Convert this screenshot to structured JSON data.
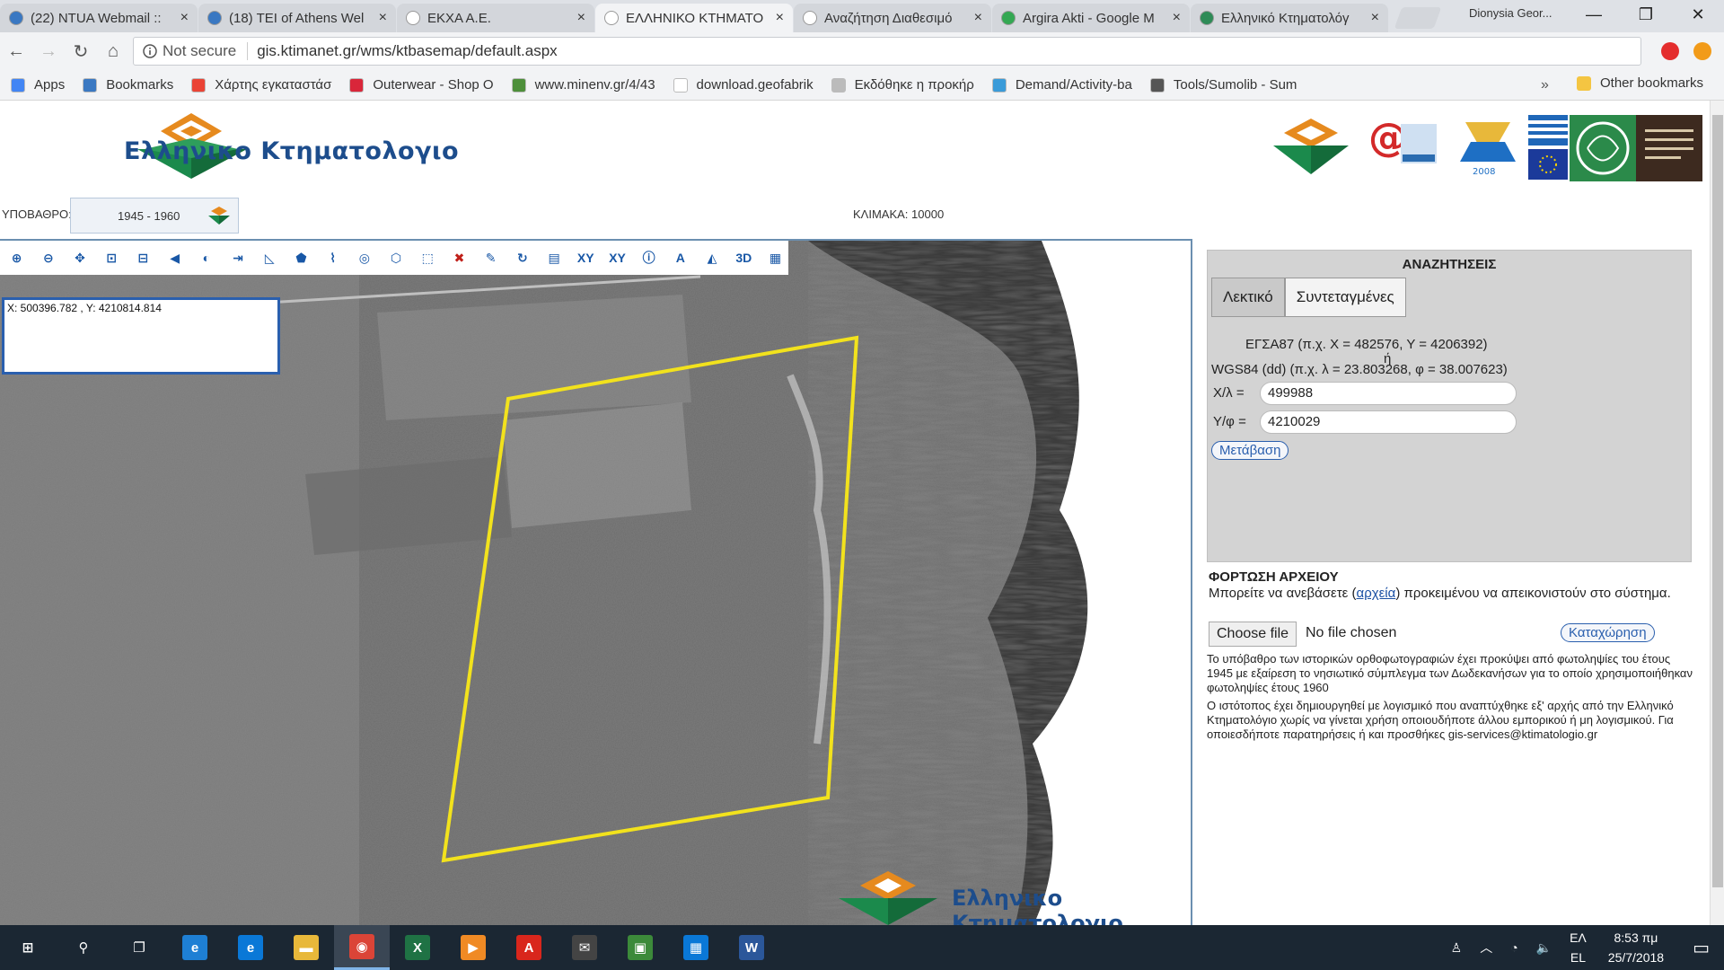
{
  "browser": {
    "tabs": [
      {
        "label": "(22) NTUA Webmail ::",
        "fav": "#3a78c2",
        "active": false
      },
      {
        "label": "(18) TEI of Athens Wel",
        "fav": "#3a78c2",
        "active": false
      },
      {
        "label": "ΕΚΧΑ Α.Ε.",
        "fav": "#ffffff",
        "active": false
      },
      {
        "label": "ΕΛΛΗΝΙΚΟ ΚΤΗΜΑΤΟ",
        "fav": "#ffffff",
        "active": true
      },
      {
        "label": "Αναζήτηση Διαθεσιμό",
        "fav": "#ffffff",
        "active": false
      },
      {
        "label": "Argira Akti - Google M",
        "fav": "#34a853",
        "active": false
      },
      {
        "label": "Ελληνικό Κτηματολόγ",
        "fav": "#2e8b57",
        "active": false
      }
    ],
    "tab_close": "×",
    "profile_name": "Dionysia Geor...",
    "window_buttons": [
      "—",
      "❐",
      "✕"
    ],
    "nav_icons": [
      "←",
      "→",
      "↻",
      "⌂"
    ],
    "security_text": "Not secure",
    "url": "gis.ktimanet.gr/wms/ktbasemap/default.aspx",
    "star": "☆"
  },
  "bookmarks": {
    "items": [
      {
        "label": "Apps",
        "color": "#4285f4"
      },
      {
        "label": "Bookmarks",
        "color": "#3a78c2"
      },
      {
        "label": "Χάρτης εγκαταστάσ",
        "color": "#ea4335"
      },
      {
        "label": "Outerwear - Shop O",
        "color": "#d9263a"
      },
      {
        "label": "www.minenv.gr/4/43",
        "color": "#4d8f3a"
      },
      {
        "label": "download.geofabrik",
        "color": "#ffffff"
      },
      {
        "label": "Εκδόθηκε η προκήρ",
        "color": "#bbbbbb"
      },
      {
        "label": "Demand/Activity-ba",
        "color": "#3a9bd9"
      },
      {
        "label": "Tools/Sumolib - Sum",
        "color": "#555555"
      }
    ],
    "more": "»",
    "other": "Other bookmarks"
  },
  "header": {
    "logo_text": "Ελληνικο Κτηματολογιο",
    "ypobathro_label": "ΥΠΟΒΑΘΡΟ:",
    "ypobathro_value": "1945 - 1960",
    "scale_text": "ΚΛΙΜΑΚΑ: 10000"
  },
  "map": {
    "tools": [
      {
        "name": "zoom-in-tool-icon",
        "glyph": "⊕"
      },
      {
        "name": "zoom-out-tool-icon",
        "glyph": "⊖"
      },
      {
        "name": "pan-tool-icon",
        "glyph": "✥"
      },
      {
        "name": "zoom-box-in-icon",
        "glyph": "⊡"
      },
      {
        "name": "zoom-box-out-icon",
        "glyph": "⊟"
      },
      {
        "name": "previous-extent-icon",
        "glyph": "◀"
      },
      {
        "name": "full-extent-icon",
        "glyph": "◐"
      },
      {
        "name": "measure-distance-icon",
        "glyph": "⇥"
      },
      {
        "name": "measure-angle-icon",
        "glyph": "◺"
      },
      {
        "name": "measure-area-icon",
        "glyph": "⬟"
      },
      {
        "name": "draw-line-icon",
        "glyph": "⌇"
      },
      {
        "name": "draw-circle-icon",
        "glyph": "◎"
      },
      {
        "name": "draw-polygon-icon",
        "glyph": "⬡"
      },
      {
        "name": "select-icon",
        "glyph": "⬚"
      },
      {
        "name": "clear-icon",
        "glyph": "✖"
      },
      {
        "name": "edit-icon",
        "glyph": "✎"
      },
      {
        "name": "refresh-icon",
        "glyph": "↻"
      },
      {
        "name": "report-icon",
        "glyph": "▤"
      },
      {
        "name": "xy-table-icon",
        "glyph": "XY"
      },
      {
        "name": "xy-goto-icon",
        "glyph": "XY"
      },
      {
        "name": "info-icon",
        "glyph": "ⓘ"
      },
      {
        "name": "label-icon",
        "glyph": "A"
      },
      {
        "name": "layers-icon",
        "glyph": "◭"
      },
      {
        "name": "3d-view-icon",
        "glyph": "3D"
      },
      {
        "name": "legend-icon",
        "glyph": "▦"
      }
    ],
    "coords": "X: 500396.782 , Y: 4210814.814",
    "watermark": "Ελληνικο Κτηματολογιο"
  },
  "search": {
    "title": "ΑΝΑΖΗΤΗΣΕΙΣ",
    "tab_text": "Λεκτικό",
    "tab_coords": "Συντεταγμένες",
    "egsa_line": "ΕΓΣΑ87 (π.χ. Χ = 482576, Υ = 4206392)",
    "or_text": "ή",
    "wgs_line": "WGS84 (dd) (π.χ. λ = 23.803268, φ = 38.007623)",
    "x_label": "Χ/λ =",
    "x_value": "499988",
    "y_label": "Υ/φ =",
    "y_value": "4210029",
    "go_button": "Μετάβαση"
  },
  "upload": {
    "title": "ΦΟΡΤΩΣΗ ΑΡΧΕΙΟΥ",
    "text_before": "Μπορείτε να ανεβάσετε (",
    "link": "αρχεία",
    "text_after": ") προκειμένου να απεικονιστούν στο σύστημα.",
    "choose_button": "Choose file",
    "no_file": "No file chosen",
    "submit_button": "Καταχώρηση",
    "info1": "Το υπόβαθρο των ιστορικών ορθοφωτογραφιών έχει προκύψει από φωτοληψίες του έτους 1945 με εξαίρεση το νησιωτικό σύμπλεγμα των Δωδεκανήσων για το οποίο χρησιμοποιήθηκαν φωτοληψίες έτους 1960",
    "info2": "Ο ιστότοπος έχει δημιουργηθεί με λογισμικό που αναπτύχθηκε εξ' αρχής από την Ελληνικό Κτηματολόγιο χωρίς να γίνεται χρήση οποιουδήποτε άλλου εμπορικού ή μη λογισμικού. Για οποιεσδήποτε παρατηρήσεις ή και προσθήκες gis-services@ktimatologio.gr"
  },
  "taskbar": {
    "apps": [
      {
        "name": "start-icon",
        "glyph": "⊞",
        "bg": "transparent",
        "active": false
      },
      {
        "name": "search-icon",
        "glyph": "⚲",
        "bg": "transparent",
        "active": false
      },
      {
        "name": "task-view-icon",
        "glyph": "❐",
        "bg": "transparent",
        "active": false
      },
      {
        "name": "internet-explorer-icon",
        "glyph": "e",
        "bg": "#1e7fd4",
        "active": false
      },
      {
        "name": "edge-icon",
        "glyph": "e",
        "bg": "#0a78d7",
        "active": false
      },
      {
        "name": "file-explorer-icon",
        "glyph": "▬",
        "bg": "#e8b83a",
        "active": false
      },
      {
        "name": "chrome-icon",
        "glyph": "◉",
        "bg": "#db4437",
        "active": true
      },
      {
        "name": "excel-icon",
        "glyph": "X",
        "bg": "#1f7244",
        "active": false
      },
      {
        "name": "media-player-icon",
        "glyph": "▶",
        "bg": "#f08a24",
        "active": false
      },
      {
        "name": "acrobat-icon",
        "glyph": "A",
        "bg": "#d9261c",
        "active": false
      },
      {
        "name": "mail-icon",
        "glyph": "✉",
        "bg": "#444444",
        "active": false
      },
      {
        "name": "photos-icon",
        "glyph": "▣",
        "bg": "#3c8a3a",
        "active": false
      },
      {
        "name": "store-icon",
        "glyph": "▦",
        "bg": "#0a78d7",
        "active": false
      },
      {
        "name": "word-icon",
        "glyph": "W",
        "bg": "#2b579a",
        "active": false
      }
    ],
    "tray_icons": [
      "♙",
      "︿",
      "◔",
      "🔈"
    ],
    "lang_top": "ΕΛ",
    "lang_bottom": "EL",
    "time": "8:53 πμ",
    "date": "25/7/2018",
    "notify": "▭"
  }
}
